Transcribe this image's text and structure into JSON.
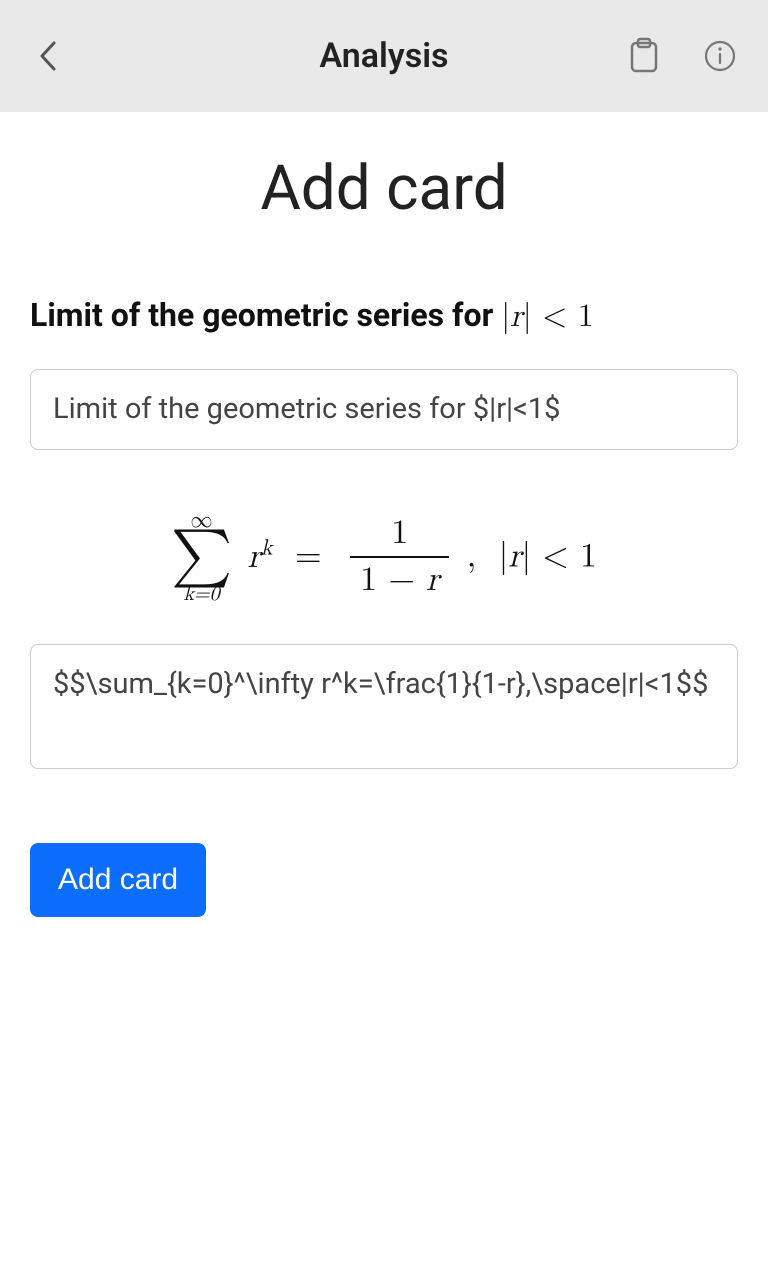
{
  "header": {
    "title": "Analysis"
  },
  "page": {
    "heading": "Add card"
  },
  "card": {
    "front_preview_prefix": "Limit of the geometric series for ",
    "front_preview_math": "|r| < 1",
    "front_input_value": "Limit of the geometric series for $|r|<1$",
    "back_input_value": "$$\\sum_{k=0}^\\infty r^k=\\frac{1}{1-r},\\space|r|<1$$"
  },
  "actions": {
    "add_card_label": "Add card"
  }
}
